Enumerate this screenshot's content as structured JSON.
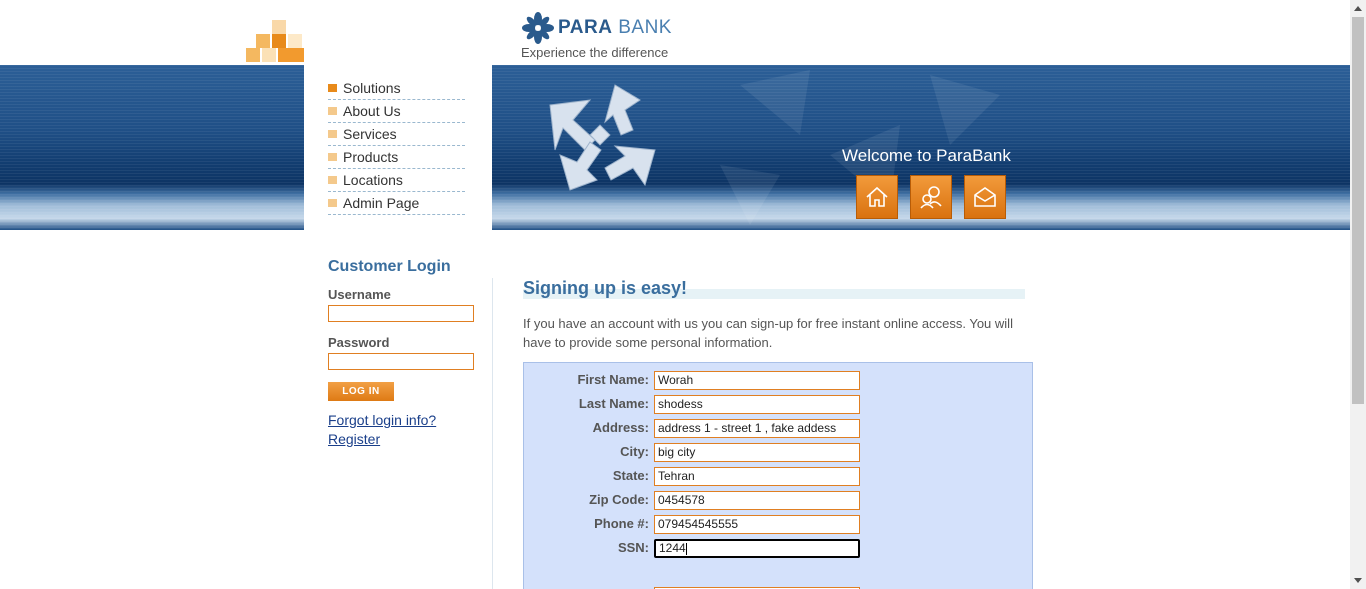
{
  "brand": {
    "name_bold": "PARA",
    "name_regular": "BANK",
    "tagline": "Experience the difference"
  },
  "nav": [
    {
      "label": "Solutions",
      "active": true
    },
    {
      "label": "About Us",
      "active": false
    },
    {
      "label": "Services",
      "active": false
    },
    {
      "label": "Products",
      "active": false
    },
    {
      "label": "Locations",
      "active": false
    },
    {
      "label": "Admin Page",
      "active": false
    }
  ],
  "banner": {
    "welcome": "Welcome to ParaBank"
  },
  "header_buttons": [
    "home-icon",
    "contact-icon",
    "email-icon"
  ],
  "login": {
    "title": "Customer Login",
    "username_label": "Username",
    "username_value": "",
    "password_label": "Password",
    "password_value": "",
    "button_label": "LOG IN",
    "forgot_link": "Forgot login info?",
    "register_link": "Register"
  },
  "signup": {
    "title": "Signing up is easy!",
    "intro": "If you have an account with us you can sign-up for free instant online access. You will have to provide some personal information.",
    "fields": [
      {
        "label": "First Name:",
        "value": "Worah"
      },
      {
        "label": "Last Name:",
        "value": "shodess"
      },
      {
        "label": "Address:",
        "value": "address 1 - street 1 , fake addess"
      },
      {
        "label": "City:",
        "value": "big city"
      },
      {
        "label": "State:",
        "value": "Tehran"
      },
      {
        "label": "Zip Code:",
        "value": "0454578"
      },
      {
        "label": "Phone #:",
        "value": "079454545555"
      },
      {
        "label": "SSN:",
        "value": "1244",
        "focused": true
      }
    ]
  },
  "colors": {
    "accent_orange": "#e07f22",
    "title_blue": "#3a6e9e",
    "form_bg": "#d4e1fb",
    "banner_blue": "#1f4f86"
  }
}
